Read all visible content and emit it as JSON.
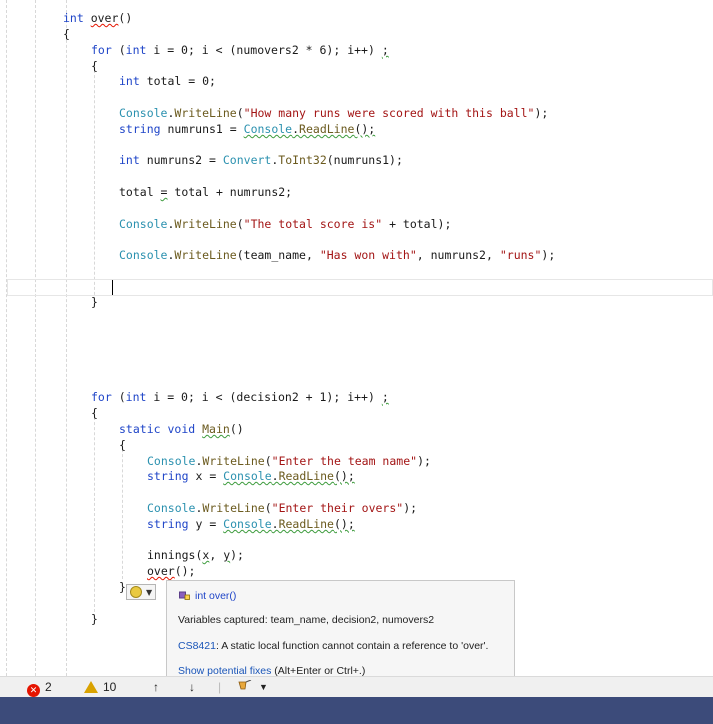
{
  "editor": {
    "lines": {
      "l1_a": "int ",
      "l1_b": "over",
      "l1_c": "()",
      "l2": "{",
      "l3_kw": "for",
      "l3_a": " (",
      "l3_kw2": "int",
      "l3_b": " i = 0; i < (numovers2 * 6); i++) ",
      "l3_semi": ";",
      "l4": "{",
      "l5_kw": "int",
      "l5_b": " total = 0;",
      "l6_ty": "Console",
      "l6_a": ".",
      "l6_mt": "WriteLine",
      "l6_b": "(",
      "l6_str": "\"How many runs were scored with this ball\"",
      "l6_c": ");",
      "l7_kw": "string",
      "l7_b": " numruns1 = ",
      "l7_ty": "Console",
      "l7_a": ".",
      "l7_mt": "ReadLine",
      "l7_c": "();",
      "l8_kw": "int",
      "l8_b": " numruns2 = ",
      "l8_ty": "Convert",
      "l8_a": ".",
      "l8_mt": "ToInt32",
      "l8_c": "(numruns1);",
      "l9_a": "total ",
      "l9_eq": "=",
      "l9_b": " total + numruns2;",
      "l10_ty": "Console",
      "l10_a": ".",
      "l10_mt": "WriteLine",
      "l10_b": "(",
      "l10_str": "\"The total score is\"",
      "l10_c": " + total);",
      "l11_ty": "Console",
      "l11_a": ".",
      "l11_mt": "WriteLine",
      "l11_b": "(team_name, ",
      "l11_str": "\"Has won with\"",
      "l11_c": ", numruns2, ",
      "l11_str2": "\"runs\"",
      "l11_d": ");",
      "l12": "}",
      "l13_kw": "for",
      "l13_a": " (",
      "l13_kw2": "int",
      "l13_b": " i = 0; i < (decision2 + 1); i++) ",
      "l13_semi": ";",
      "l14": "{",
      "l15_kw": "static",
      "l15_a": " ",
      "l15_kw2": "void",
      "l15_b": " ",
      "l15_mt": "Main",
      "l15_c": "()",
      "l16": "{",
      "l17_ty": "Console",
      "l17_a": ".",
      "l17_mt": "WriteLine",
      "l17_b": "(",
      "l17_str": "\"Enter the team name\"",
      "l17_c": ");",
      "l18_kw": "string",
      "l18_b": " x = ",
      "l18_ty": "Console",
      "l18_a": ".",
      "l18_mt": "ReadLine",
      "l18_c": "();",
      "l19_ty": "Console",
      "l19_a": ".",
      "l19_mt": "WriteLine",
      "l19_b": "(",
      "l19_str": "\"Enter their overs\"",
      "l19_c": ");",
      "l20_kw": "string",
      "l20_b": " y = ",
      "l20_ty": "Console",
      "l20_a": ".",
      "l20_mt": "ReadLine",
      "l20_c": "();",
      "l21_a": "innings(",
      "l21_x": "x",
      "l21_b": ", ",
      "l21_y": "y",
      "l21_c": ");",
      "l22_a": "over",
      "l22_b": "();",
      "l23": "}",
      "l24": "}"
    }
  },
  "quickinfo": {
    "signature": "int over()",
    "captured": "Variables captured: team_name, decision2, numovers2",
    "error_code": "CS8421",
    "error_text": ": A static local function cannot contain a reference to 'over'.",
    "fix_link": "Show potential fixes",
    "fix_hint": " (Alt+Enter or Ctrl+.)"
  },
  "statusbar": {
    "errors": "2",
    "warnings": "10",
    "up_arrow": "↑",
    "down_arrow": "↓"
  },
  "colors": {
    "keyword": "#1f45c8",
    "type": "#2b91af",
    "string": "#a31515",
    "error": "#e51400",
    "warning": "#d9a200"
  }
}
